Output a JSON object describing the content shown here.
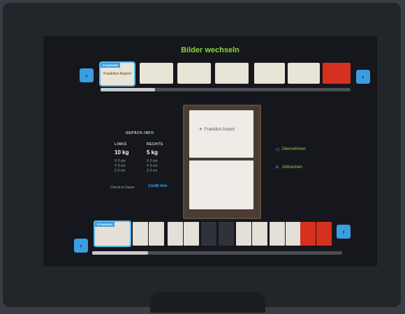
{
  "title": "Bilder wechseln",
  "nav": {
    "left_icon": "chevron-left-icon",
    "right_icon": "chevron-right-icon",
    "left_glyph": "‹",
    "right_glyph": "›"
  },
  "thumbs": {
    "standard_tag": "STANDARD",
    "standard_brand": "Frankfurt Airport"
  },
  "info": {
    "heading": "GEPÄCK-INFO",
    "left_label": "LINKS",
    "right_label": "RECHTS",
    "left_weight": "10 kg",
    "right_weight": "5 kg",
    "left_dims": [
      "X 0 cm",
      "Y 0 cm",
      "Z 0 cm"
    ],
    "right_dims": [
      "X 0 cm",
      "Y 0 cm",
      "Z 0 cm"
    ],
    "checkin_label": "Check-in Dauer",
    "checkin_value": "1m48 min"
  },
  "preview": {
    "logo_text": "Frankfurt Airport"
  },
  "actions": {
    "apply_label": "Übernehmen",
    "cancel_label": "Abbrechen"
  },
  "bags": {
    "standard_tag": "STANDARD"
  },
  "colors": {
    "accent_green": "#8fd43a",
    "accent_blue": "#3a9ee0",
    "alert_red": "#d6311f"
  }
}
